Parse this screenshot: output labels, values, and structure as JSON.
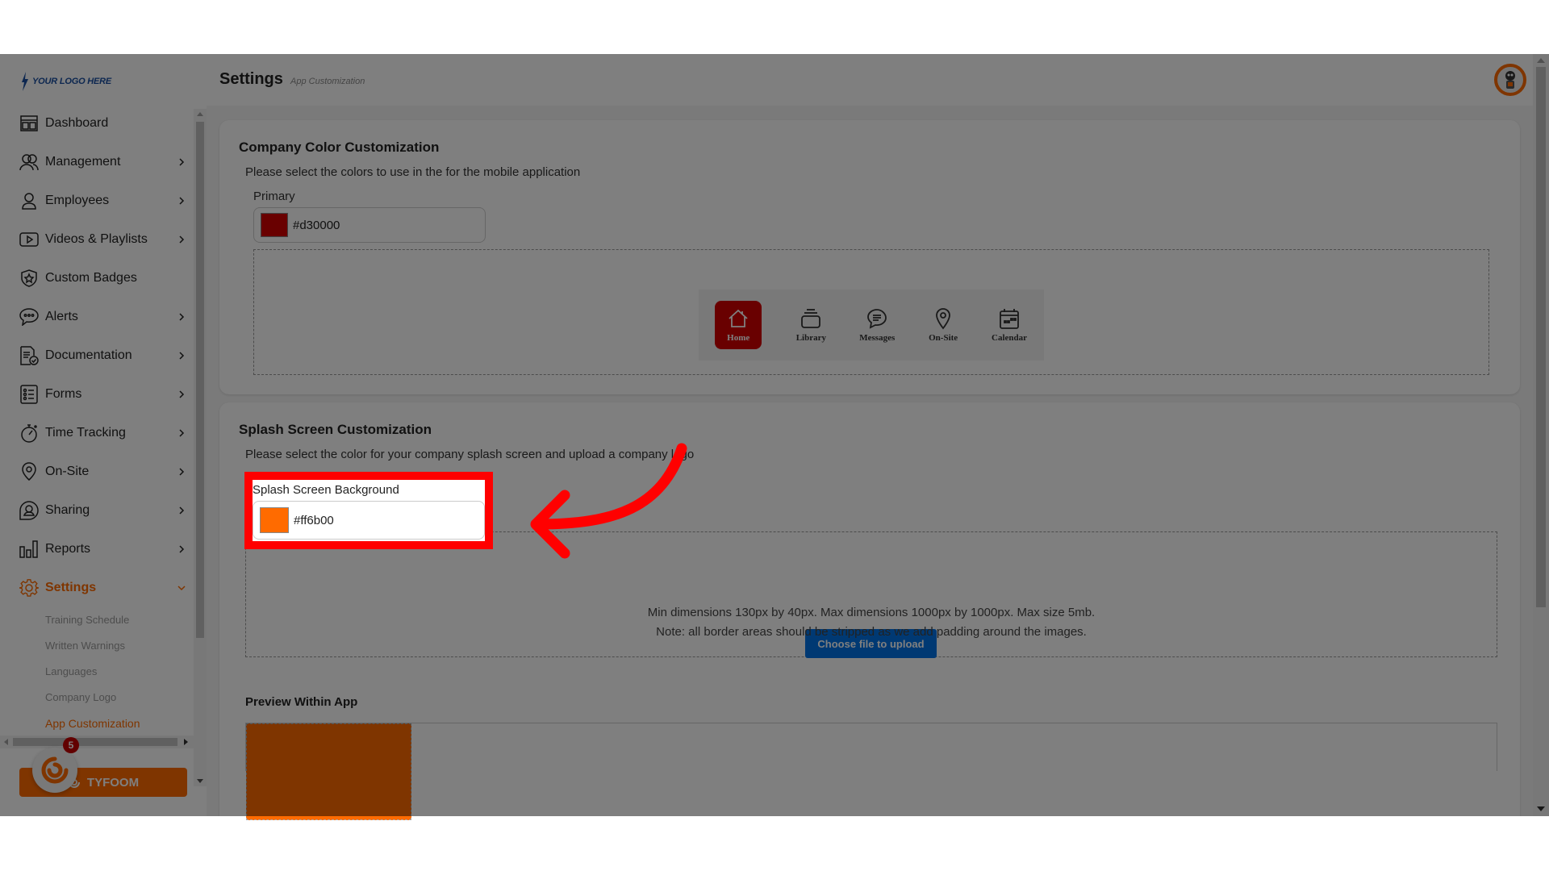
{
  "logo": {
    "text": "YOUR LOGO HERE"
  },
  "header": {
    "title": "Settings",
    "subtitle": "App Customization",
    "avatar_icon": "user-avatar"
  },
  "sidebar": {
    "items": [
      {
        "label": "Dashboard",
        "icon": "dashboard-icon",
        "has_chevron": false
      },
      {
        "label": "Management",
        "icon": "users-icon",
        "has_chevron": true
      },
      {
        "label": "Employees",
        "icon": "user-icon",
        "has_chevron": true
      },
      {
        "label": "Videos & Playlists",
        "icon": "video-icon",
        "has_chevron": true
      },
      {
        "label": "Custom Badges",
        "icon": "badge-icon",
        "has_chevron": false
      },
      {
        "label": "Alerts",
        "icon": "chat-bubble-icon",
        "has_chevron": true
      },
      {
        "label": "Documentation",
        "icon": "document-icon",
        "has_chevron": true
      },
      {
        "label": "Forms",
        "icon": "list-icon",
        "has_chevron": true
      },
      {
        "label": "Time Tracking",
        "icon": "stopwatch-icon",
        "has_chevron": true
      },
      {
        "label": "On-Site",
        "icon": "map-pin-icon",
        "has_chevron": true
      },
      {
        "label": "Sharing",
        "icon": "share-user-icon",
        "has_chevron": true
      },
      {
        "label": "Reports",
        "icon": "bar-chart-icon",
        "has_chevron": true
      },
      {
        "label": "Settings",
        "icon": "gear-icon",
        "has_chevron": true,
        "active": true
      }
    ],
    "settings_sub_items": [
      {
        "label": "Training Schedule"
      },
      {
        "label": "Written Warnings"
      },
      {
        "label": "Languages"
      },
      {
        "label": "Company Logo"
      },
      {
        "label": "App Customization",
        "active": true
      }
    ],
    "tyfoom_button": "TYFOOM",
    "tyfoom_badge_count": "5"
  },
  "company_colors": {
    "title": "Company Color Customization",
    "description": "Please select the colors to use in the for the mobile application",
    "primary_label": "Primary",
    "primary_value": "#d30000",
    "primary_color": "#d30000",
    "preview_tabs": [
      {
        "label": "Home",
        "icon": "home-icon",
        "active": true
      },
      {
        "label": "Library",
        "icon": "library-icon"
      },
      {
        "label": "Messages",
        "icon": "messages-icon"
      },
      {
        "label": "On-Site",
        "icon": "map-pin-icon"
      },
      {
        "label": "Calendar",
        "icon": "calendar-icon"
      }
    ]
  },
  "splash": {
    "title": "Splash Screen Customization",
    "description": "Please select the color for your company splash screen and upload a company logo",
    "background_label": "Splash Screen Background",
    "background_value": "#ff6b00",
    "background_color": "#ff6b00",
    "upload_button": "Choose file to upload",
    "upload_note_1": "Min dimensions 130px by 40px. Max dimensions 1000px by 1000px. Max size 5mb.",
    "upload_note_2": "Note: all border areas should be stripped as we add padding around the images.",
    "preview_title": "Preview Within App"
  },
  "colors": {
    "accent": "#ff6b00",
    "primary": "#d30000",
    "upload_button": "#0073e6",
    "highlight": "#ff0000"
  }
}
